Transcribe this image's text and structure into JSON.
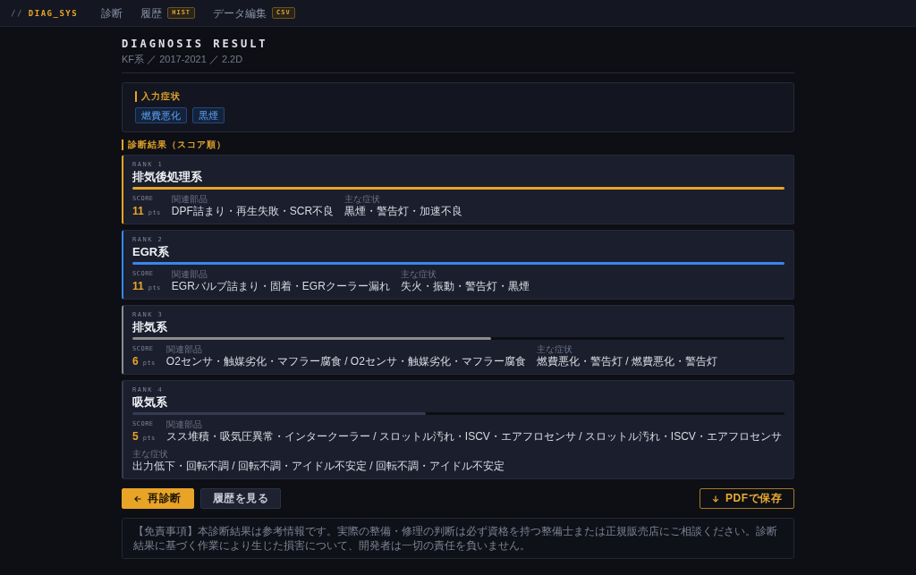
{
  "nav": {
    "logo_prefix": "//",
    "logo": "DIAG_SYS",
    "items": [
      {
        "label": "診断"
      },
      {
        "label": "履歴",
        "badge": "HIST"
      },
      {
        "label": "データ編集",
        "badge": "CSV"
      }
    ]
  },
  "header": {
    "title": "DIAGNOSIS RESULT",
    "subtitle": "KF系 ／ 2017-2021 ／ 2.2D"
  },
  "input_symptoms": {
    "label": "入力症状",
    "tags": [
      "燃費悪化",
      "黒煙"
    ]
  },
  "results": {
    "label": "診断結果（スコア順）",
    "items": [
      {
        "rank": "RANK 1",
        "name": "排気後処理系",
        "color": "#e8a427",
        "level": 1,
        "score_label": "SCORE",
        "score": "11",
        "unit": "pts",
        "parts_label": "関連部品",
        "parts": "DPF詰まり・再生失敗・SCR不良",
        "symptoms_label": "主な症状",
        "symptoms": "黒煙・警告灯・加速不良"
      },
      {
        "rank": "RANK 2",
        "name": "EGR系",
        "color": "#3b86f0",
        "level": 1,
        "score_label": "SCORE",
        "score": "11",
        "unit": "pts",
        "parts_label": "関連部品",
        "parts": "EGRバルブ詰まり・固着・EGRクーラー漏れ",
        "symptoms_label": "主な症状",
        "symptoms": "失火・振動・警告灯・黒煙"
      },
      {
        "rank": "RANK 3",
        "name": "排気系",
        "color": "#8c8c8c",
        "level": 0.55,
        "score_label": "SCORE",
        "score": "6",
        "unit": "pts",
        "parts_label": "関連部品",
        "parts": "O2センサ・触媒劣化・マフラー腐食 / O2センサ・触媒劣化・マフラー腐食",
        "symptoms_label": "主な症状",
        "symptoms": "燃費悪化・警告灯 / 燃費悪化・警告灯"
      },
      {
        "rank": "RANK 4",
        "name": "吸気系",
        "color": "#363b52",
        "level": 0.45,
        "score_label": "SCORE",
        "score": "5",
        "unit": "pts",
        "parts_label": "関連部品",
        "parts": "スス堆積・吸気圧異常・インタークーラー / スロットル汚れ・ISCV・エアフロセンサ / スロットル汚れ・ISCV・エアフロセンサ",
        "symptoms_label": "主な症状",
        "symptoms": "出力低下・回転不調 / 回転不調・アイドル不安定 / 回転不調・アイドル不安定"
      }
    ]
  },
  "actions": {
    "left": [
      {
        "label": "再診断",
        "kind": "primary"
      },
      {
        "label": "履歴を見る",
        "kind": "secondary"
      }
    ],
    "right": [
      {
        "label": "PDFで保存",
        "kind": "outline"
      }
    ]
  },
  "disclaimer": "【免責事項】本診断結果は参考情報です。実際の整備・修理の判断は必ず資格を持つ整備士または正規販売店にご相談ください。診断結果に基づく作業により生じた損害について、開発者は一切の責任を負いません。"
}
